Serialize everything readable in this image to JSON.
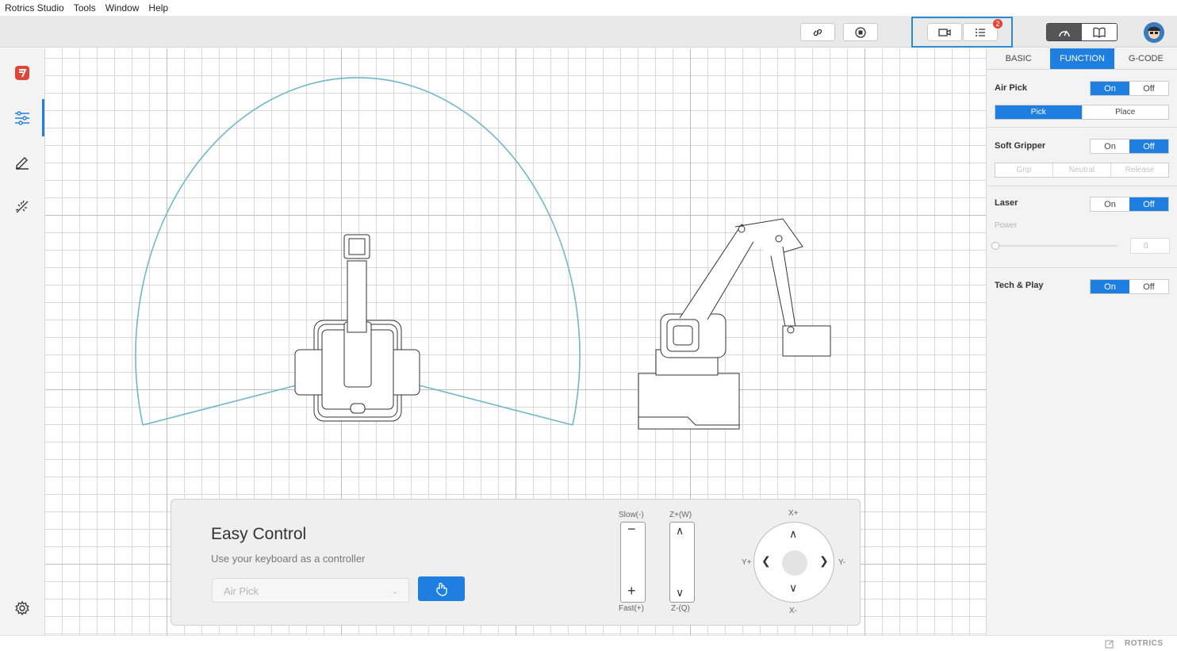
{
  "menubar": {
    "app_name": "Rotrics Studio",
    "items": [
      "Tools",
      "Window",
      "Help"
    ]
  },
  "toolbar": {
    "notification_count": "2"
  },
  "easy_control": {
    "title": "Easy Control",
    "subtitle": "Use your keyboard as a controller",
    "mode_select_value": "Air Pick",
    "speed_top_label": "Slow(-)",
    "speed_bottom_label": "Fast(+)",
    "z_top_label": "Z+(W)",
    "z_bottom_label": "Z-(Q)",
    "x_plus": "X+",
    "x_minus": "X-",
    "y_plus": "Y+",
    "y_minus": "Y-"
  },
  "right_panel": {
    "tabs": [
      "BASIC",
      "FUNCTION",
      "G-CODE"
    ],
    "active_tab": "FUNCTION",
    "air_pick": {
      "title": "Air Pick",
      "on": "On",
      "off": "Off",
      "state": "On",
      "pick": "Pick",
      "place": "Place",
      "action": "Pick"
    },
    "soft_gripper": {
      "title": "Soft Gripper",
      "on": "On",
      "off": "Off",
      "state": "Off",
      "grip": "Grip",
      "neutral": "Neutral",
      "release": "Release"
    },
    "laser": {
      "title": "Laser",
      "on": "On",
      "off": "Off",
      "state": "Off",
      "power_label": "Power",
      "power_value": "0"
    },
    "teach_play": {
      "title": "Tech & Play",
      "on": "On",
      "off": "Off",
      "state": "On"
    }
  },
  "statusbar": {
    "brand": "ROTRICS"
  },
  "colors": {
    "accent": "#1e7fe0",
    "workspace_arc": "#6fb7c9",
    "badge": "#e0453a"
  }
}
